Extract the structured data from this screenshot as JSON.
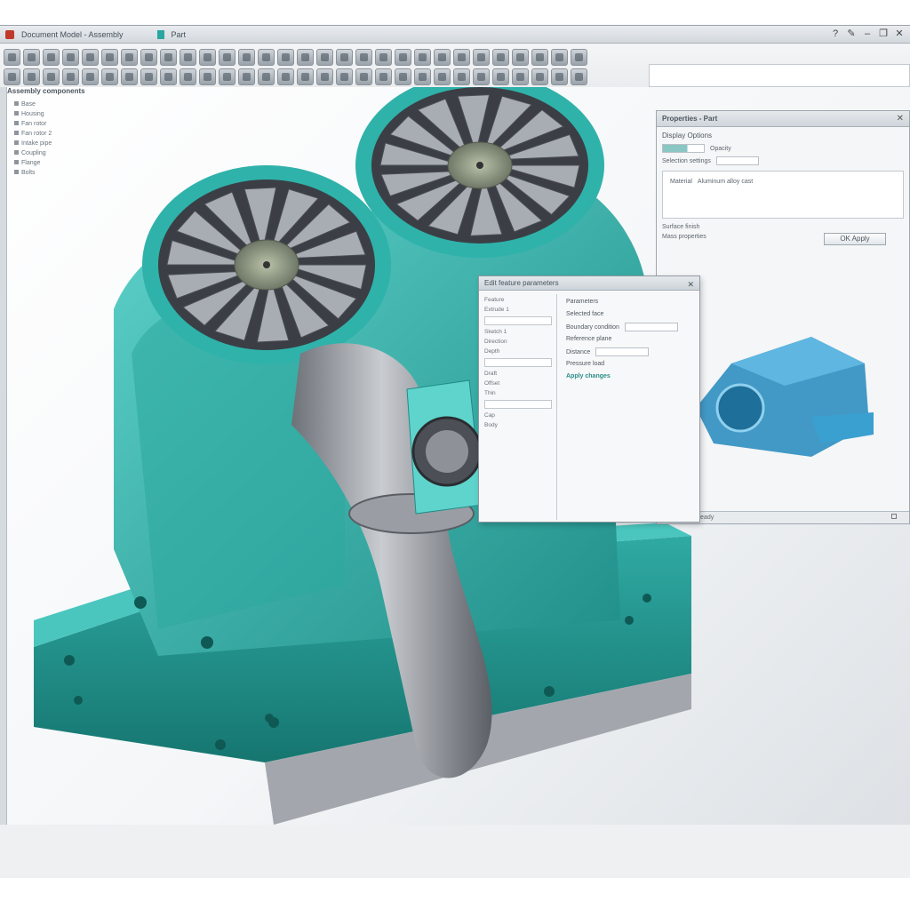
{
  "window": {
    "title": "Document Model - Assembly",
    "tab": "Part"
  },
  "tree": {
    "title": "Assembly components",
    "items": [
      "Base",
      "Housing",
      "Fan rotor",
      "Fan rotor 2",
      "Intake pipe",
      "Coupling",
      "Flange",
      "Bolts"
    ]
  },
  "properties": {
    "title": "Properties - Part",
    "subtitle": "Display Options",
    "row1_label": "Opacity",
    "row2_label": "Selection settings",
    "box_label": "Material",
    "box_value": "Aluminum alloy cast",
    "row3_label": "Surface finish",
    "row4_label": "Mass properties",
    "button_label": "OK Apply",
    "footer_text": "Ready",
    "close_icon": "close-icon"
  },
  "dialog": {
    "title": "Edit feature parameters",
    "left_lines": [
      "Feature",
      "Extrude 1",
      "Sketch 1",
      "Direction",
      "Depth",
      "Draft",
      "Offset",
      "Thin",
      "Cap",
      "Body"
    ],
    "right_lines": [
      "Parameters",
      "Selected face",
      "Boundary condition",
      "Reference plane",
      "Distance",
      "Pressure load"
    ],
    "accent_line": "Apply changes"
  },
  "status": {
    "text": "Ready"
  },
  "colors": {
    "model_teal": "#3bbcb4",
    "model_teal_dark": "#1f8d87",
    "metal": "#8e9298",
    "preview_blue": "#2f8fc0"
  },
  "ribbon": {
    "row_count_icons": [
      "tool-icon"
    ]
  }
}
